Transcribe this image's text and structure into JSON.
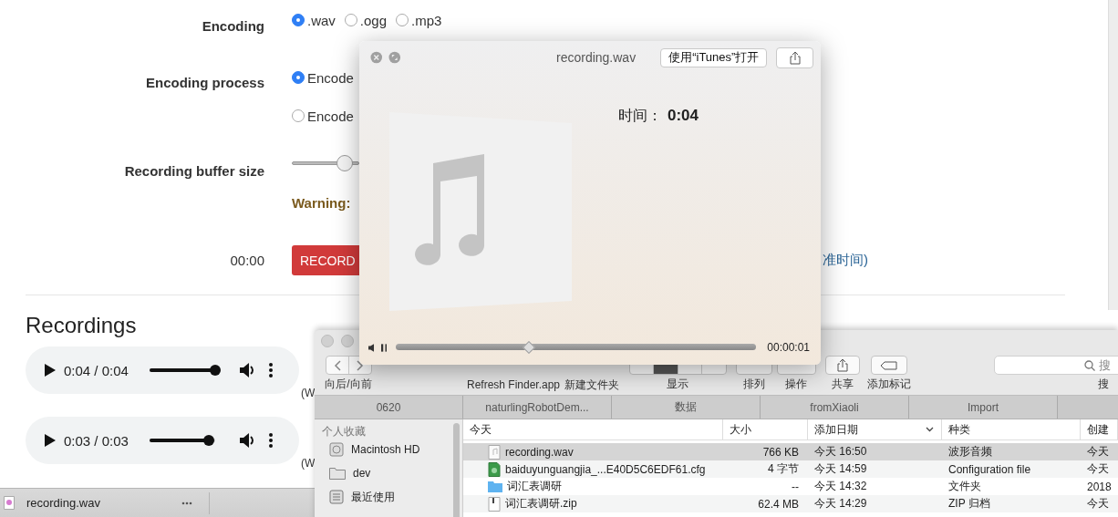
{
  "page": {
    "form": [
      {
        "kind": "radios",
        "label": "Encoding",
        "options": [
          {
            "label": ".wav",
            "selected": true
          },
          {
            "label": ".ogg",
            "selected": false
          },
          {
            "label": ".mp3",
            "selected": false
          }
        ]
      },
      {
        "kind": "radios-stacked",
        "label": "Encoding process",
        "options": [
          {
            "label": "Encode",
            "selected": true
          },
          {
            "label": "Encode",
            "selected": false
          }
        ]
      },
      {
        "kind": "slider",
        "label": "Recording buffer size",
        "level": 0.77
      },
      {
        "kind": "warning",
        "text": "Warning:"
      },
      {
        "kind": "record",
        "label": "00:00",
        "button": "RECORD",
        "note": "准时间)"
      }
    ],
    "recordings_title": "Recordings",
    "recordings": [
      {
        "time": "0:04 / 0:04",
        "level": 1.0,
        "note": "(W"
      },
      {
        "time": "0:03 / 0:03",
        "level": 0.9,
        "note": "(W"
      }
    ]
  },
  "download_bar": {
    "file": "recording.wav"
  },
  "quick_look": {
    "title": "recording.wav",
    "open_button": "使用“iTunes”打开",
    "time_label": "时间：",
    "time_value": "0:04",
    "playing": true,
    "level": 0.37,
    "elapsed": "00:00:01"
  },
  "finder": {
    "toolbar": [
      {
        "kind": "nav",
        "label": "向后/向前"
      },
      {
        "kind": "none",
        "label": "Refresh Finder.app"
      },
      {
        "kind": "none",
        "label": "新建文件夹"
      },
      {
        "kind": "view",
        "label": "显示"
      },
      {
        "kind": "arrange",
        "label": "排列"
      },
      {
        "kind": "action",
        "label": "操作"
      },
      {
        "kind": "share",
        "label": "共享"
      },
      {
        "kind": "tag",
        "label": "添加标记"
      },
      {
        "kind": "search",
        "label": "搜",
        "placeholder": "搜"
      }
    ],
    "tabs": [
      {
        "label": "0620",
        "selected": false
      },
      {
        "label": "naturlingRobotDem...",
        "selected": false
      },
      {
        "label": "数据",
        "selected": false
      },
      {
        "label": "fromXiaoli",
        "selected": false
      },
      {
        "label": "Import",
        "selected": false
      }
    ],
    "sidebar": {
      "heading": "个人收藏",
      "items": [
        {
          "kind": "disk",
          "label": "Macintosh HD"
        },
        {
          "kind": "folder",
          "label": "dev"
        },
        {
          "kind": "recents",
          "label": "最近使用"
        }
      ]
    },
    "columns": [
      {
        "label": "今天",
        "sorted": false
      },
      {
        "label": "大小",
        "sorted": false
      },
      {
        "label": "添加日期",
        "sorted": true
      },
      {
        "label": "种类",
        "sorted": false
      },
      {
        "label": "创建",
        "sorted": false
      }
    ],
    "rows": [
      {
        "kind": "audio",
        "name": "recording.wav",
        "size": "766 KB",
        "added": "今天 16:50",
        "type": "波形音频",
        "created": "今天",
        "selected": true
      },
      {
        "kind": "config",
        "name": "baiduyunguangjia_...E40D5C6EDF61.cfg",
        "size": "4 字节",
        "added": "今天 14:59",
        "type": "Configuration file",
        "created": "今天",
        "selected": false
      },
      {
        "kind": "folder",
        "name": "词汇表调研",
        "size": "--",
        "added": "今天 14:32",
        "type": "文件夹",
        "created": "2018",
        "selected": false
      },
      {
        "kind": "zip",
        "name": "词汇表调研.zip",
        "size": "62.4 MB",
        "added": "今天 14:29",
        "type": "ZIP 归档",
        "created": "今天",
        "selected": false
      }
    ]
  }
}
